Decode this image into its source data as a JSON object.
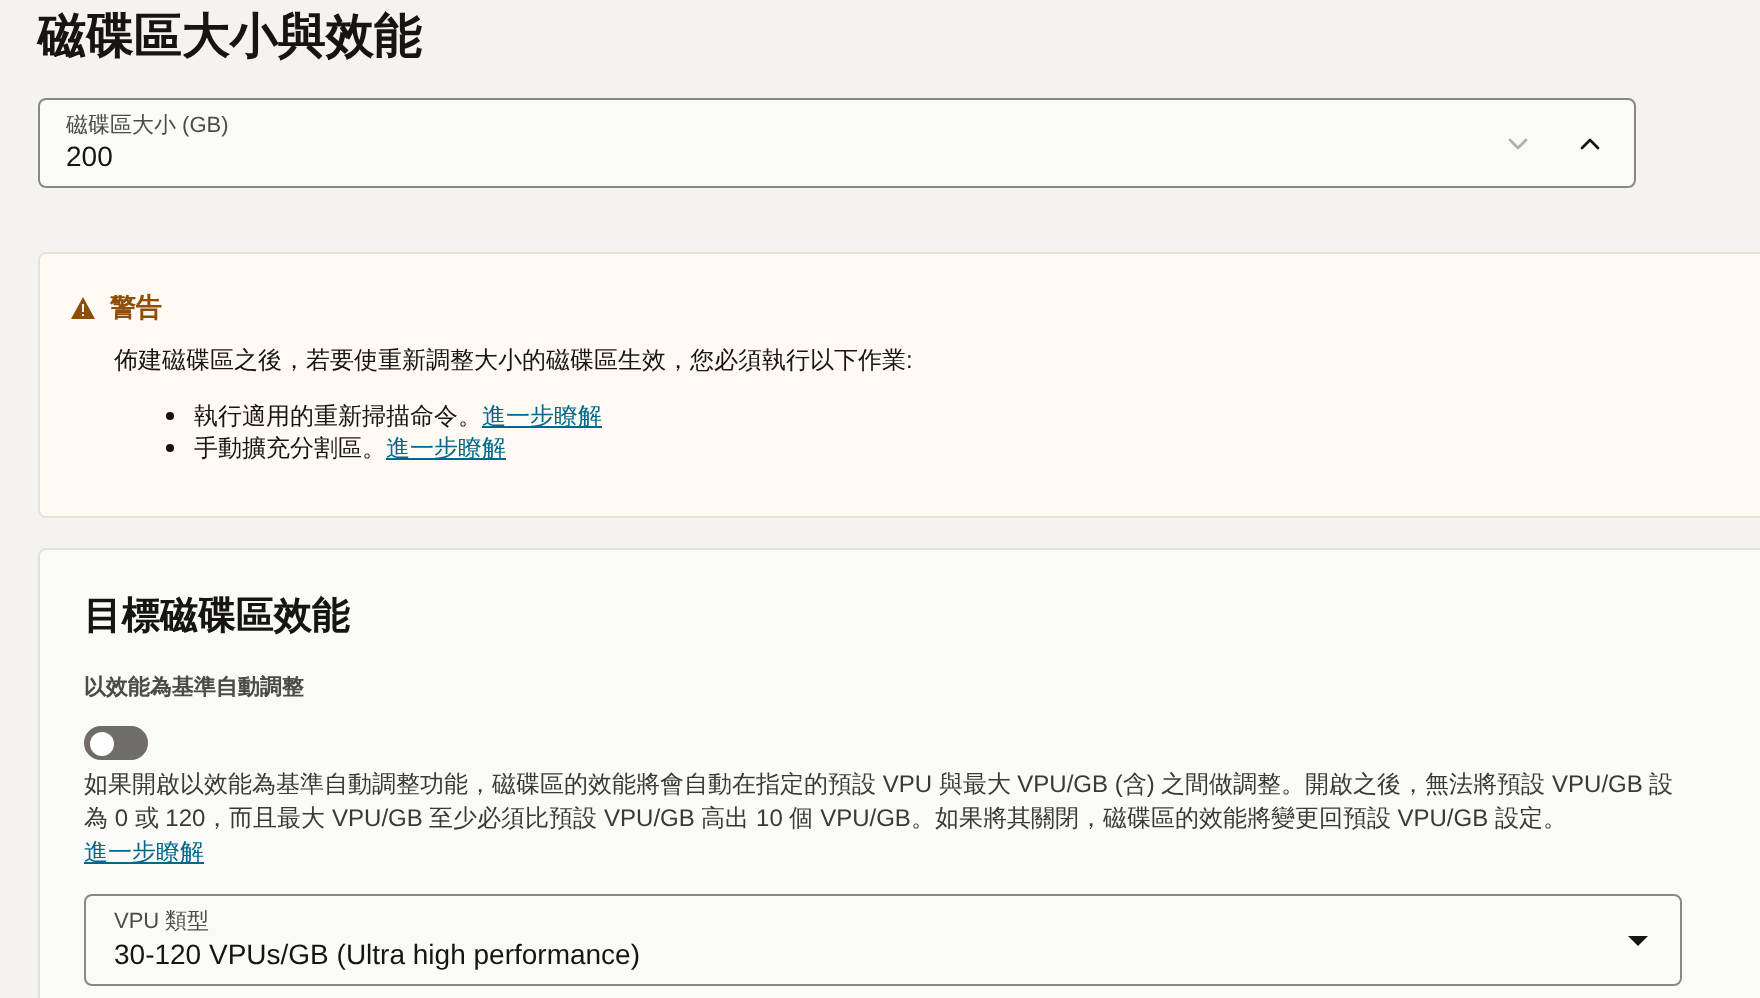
{
  "title": "磁碟區大小與效能",
  "size_field": {
    "label": "磁碟區大小 (GB)",
    "value": "200"
  },
  "warning": {
    "title": "警告",
    "message": "佈建磁碟區之後，若要使重新調整大小的磁碟區生效，您必須執行以下作業:",
    "items": [
      {
        "text": "執行適用的重新掃描命令。",
        "link": "進一步瞭解"
      },
      {
        "text": "手動擴充分割區。",
        "link": "進一步瞭解"
      }
    ]
  },
  "performance": {
    "title": "目標磁碟區效能",
    "auto_tune": {
      "label": "以效能為基準自動調整",
      "on": false
    },
    "description": "如果開啟以效能為基準自動調整功能，磁碟區的效能將會自動在指定的預設 VPU 與最大 VPU/GB (含) 之間做調整。開啟之後，無法將預設 VPU/GB 設為 0 或 120，而且最大 VPU/GB 至少必須比預設 VPU/GB 高出 10 個 VPU/GB。如果將其關閉，磁碟區的效能將變更回預設 VPU/GB 設定。",
    "description_link": "進一步瞭解",
    "vpu_select": {
      "label": "VPU 類型",
      "value": "30-120 VPUs/GB (Ultra high performance)"
    }
  }
}
